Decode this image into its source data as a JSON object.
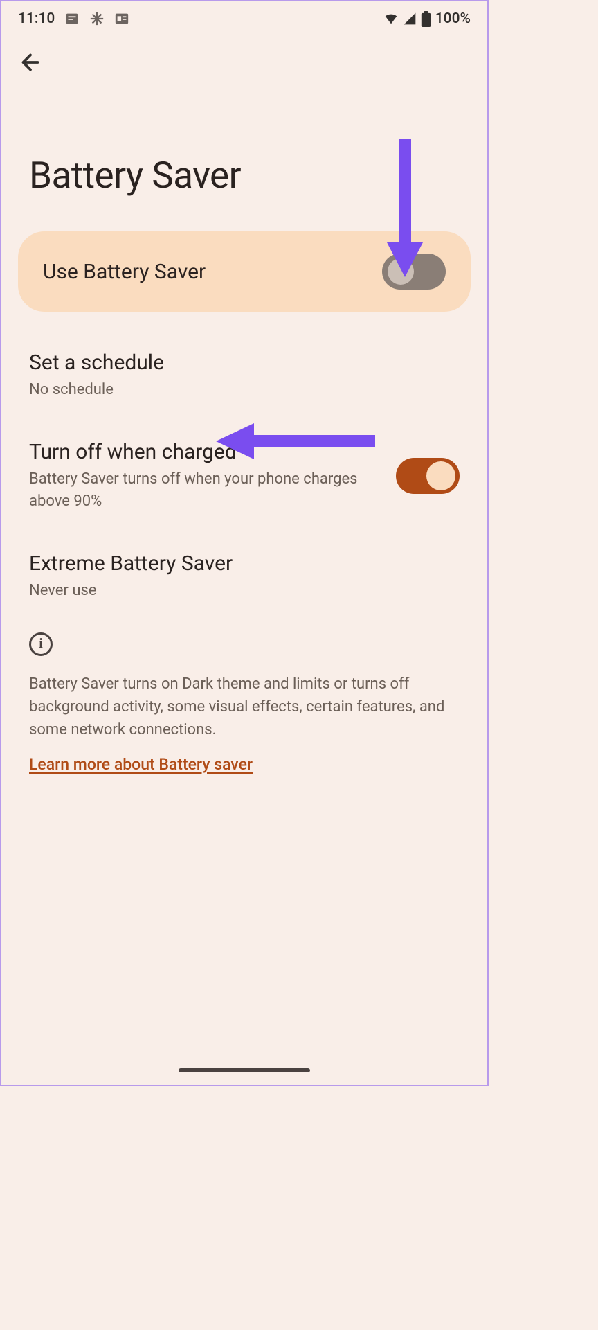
{
  "status_bar": {
    "time": "11:10",
    "battery_percent": "100%"
  },
  "header": {
    "title": "Battery Saver"
  },
  "main_toggle": {
    "label": "Use Battery Saver",
    "state": "off"
  },
  "settings": {
    "schedule": {
      "title": "Set a schedule",
      "subtitle": "No schedule"
    },
    "turn_off_charged": {
      "title": "Turn off when charged",
      "subtitle": "Battery Saver turns off when your phone charges above 90%",
      "state": "on"
    },
    "extreme": {
      "title": "Extreme Battery Saver",
      "subtitle": "Never use"
    }
  },
  "info": {
    "text": "Battery Saver turns on Dark theme and limits or turns off background activity, some visual effects, certain features, and some network connections.",
    "link": "Learn more about Battery saver"
  },
  "annotations": {
    "arrow_color": "#7a4def"
  }
}
